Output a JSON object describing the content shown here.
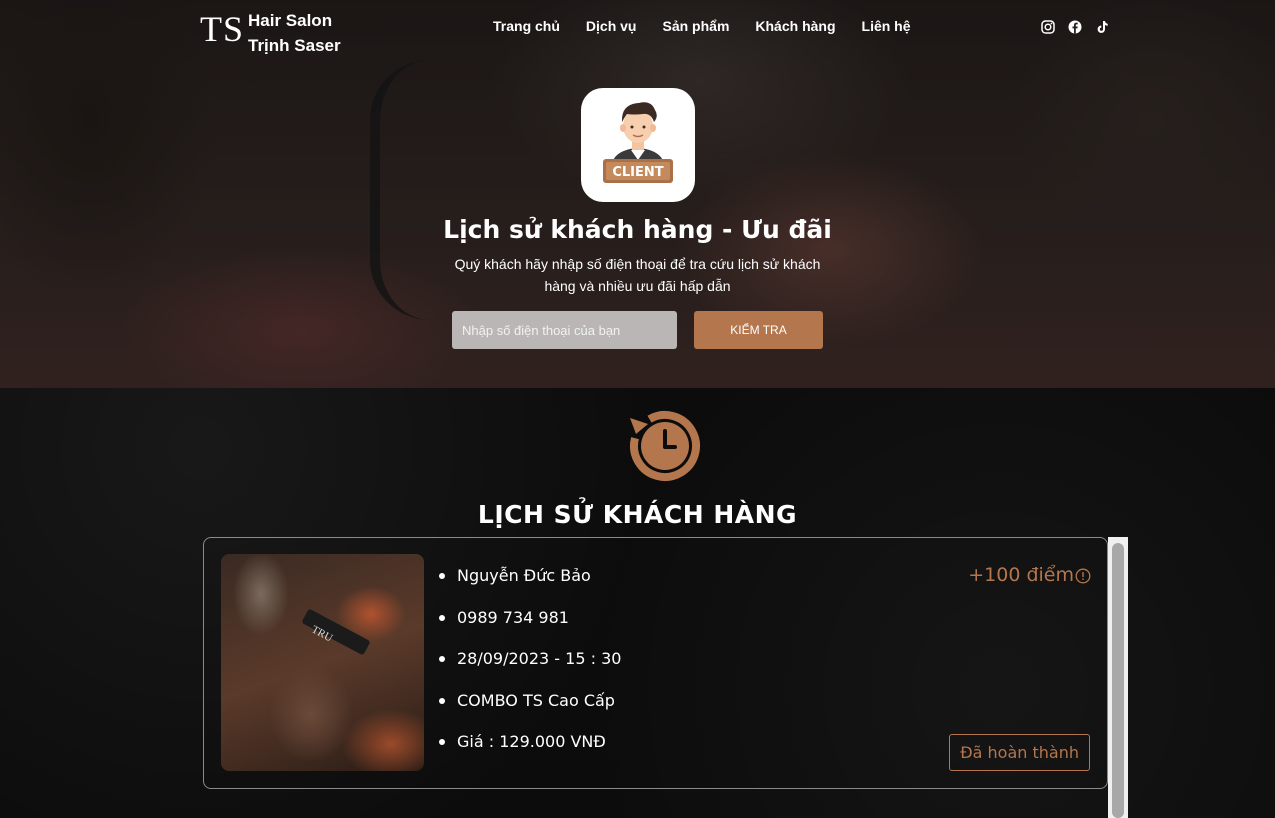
{
  "header": {
    "logo_mark": "TS",
    "logo_line1": "Hair Salon",
    "logo_line2": "Trịnh Saser",
    "nav": [
      "Trang chủ",
      "Dịch vụ",
      "Sản phẩm",
      "Khách hàng",
      "Liên hệ"
    ],
    "socials": [
      "instagram-icon",
      "facebook-icon",
      "tiktok-icon"
    ]
  },
  "hero": {
    "badge_text": "CLIENT",
    "title": "Lịch sử khách hàng - Ưu đãi",
    "subtitle": "Quý khách hãy nhập số điện thoại để tra cứu lịch sử khách hàng và nhiều ưu đãi hấp dẫn",
    "search_placeholder": "Nhập số điện thoại của bạn",
    "search_value": "",
    "button_label": "KIỂM TRA"
  },
  "history": {
    "title": "LỊCH SỬ KHÁCH HÀNG",
    "record": {
      "photo_text": "TRU",
      "name": "Nguyễn Đức Bảo",
      "phone": "0989 734 981",
      "datetime": "28/09/2023 - 15 : 30",
      "service": "COMBO TS Cao Cấp",
      "price": "Giá : 129.000 VNĐ",
      "points": "+100 điểm",
      "status": "Đã hoàn thành"
    }
  },
  "colors": {
    "accent": "#b4764d",
    "input_bg": "#b9b6b5"
  }
}
